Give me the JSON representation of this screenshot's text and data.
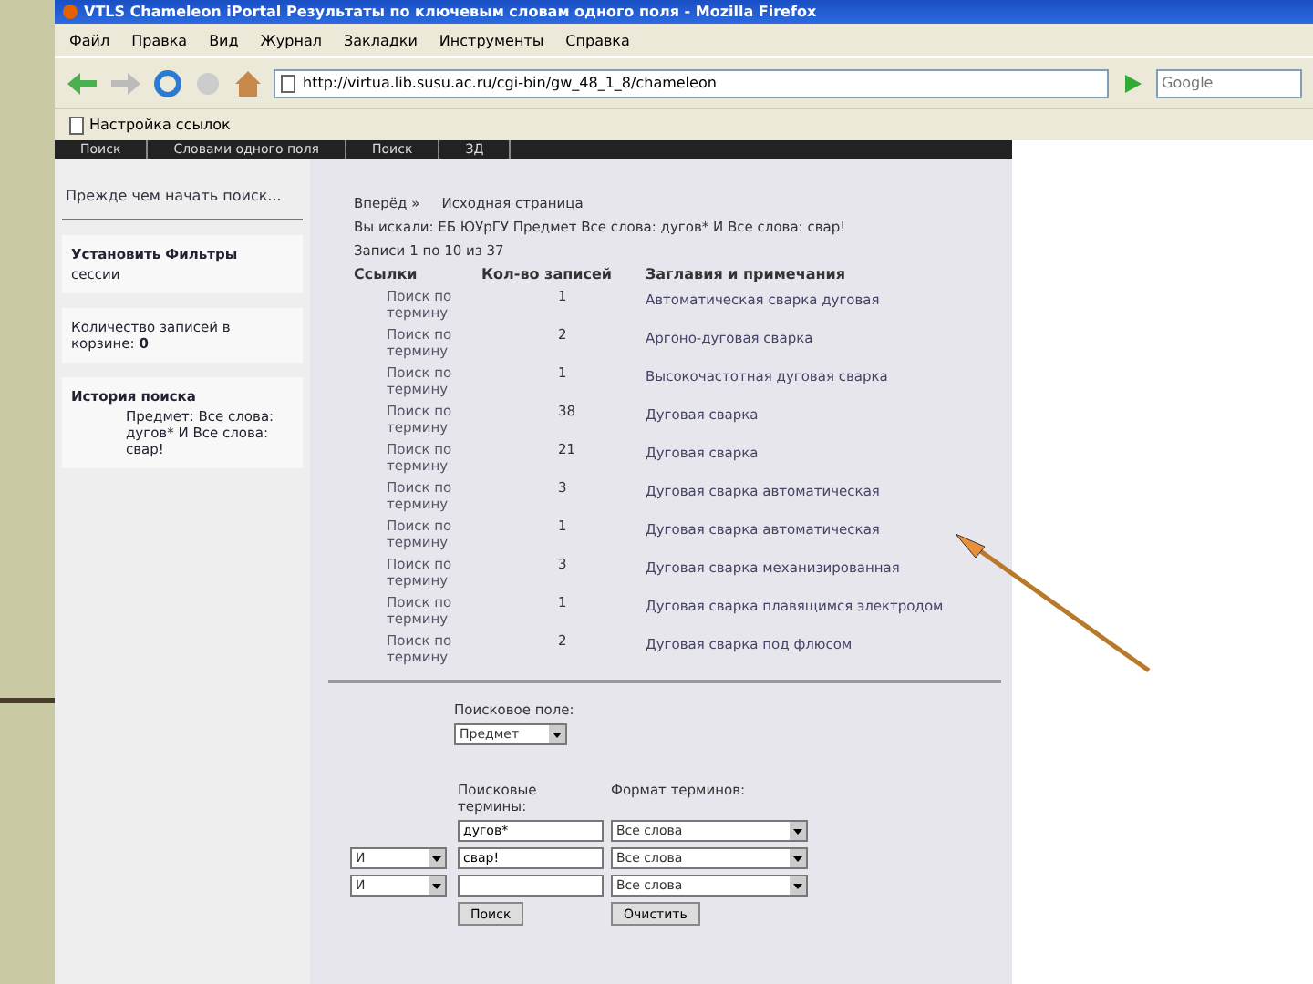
{
  "window": {
    "title": "VTLS Chameleon iPortal Результаты по ключевым словам одного поля - Mozilla Firefox"
  },
  "menu": [
    "Файл",
    "Правка",
    "Вид",
    "Журнал",
    "Закладки",
    "Инструменты",
    "Справка"
  ],
  "address_bar": {
    "value": "http://virtua.lib.susu.ac.ru/cgi-bin/gw_48_1_8/chameleon"
  },
  "web_search": {
    "placeholder": "Google"
  },
  "bookmarks": [
    "Настройка ссылок"
  ],
  "site_nav": [
    "Поиск",
    "Словами одного поля",
    "Поиск",
    "ЗД"
  ],
  "sidebar": {
    "intro": "Прежде чем начать поиск...",
    "filters": {
      "title": "Установить Фильтры",
      "subtitle": "сессии"
    },
    "cart": {
      "label": "Количество записей в корзине:",
      "count": "0"
    },
    "history": {
      "title": "История поиска",
      "entry": "Предмет: Все слова: дугов* И Все слова: свар!"
    }
  },
  "breadcrumb": [
    "Вперёд »",
    "Исходная страница"
  ],
  "query": "Вы искали: ЕБ ЮУрГУ   Предмет   Все слова: дугов* И Все слова: свар!",
  "record_range": "Записи 1 по 10 из 37",
  "table": {
    "columns": [
      "Ссылки",
      "Кол-во записей",
      "Заглавия и примечания"
    ],
    "rows": [
      {
        "link": "Поиск по термину",
        "count": "1",
        "title": "Автоматическая сварка дуговая"
      },
      {
        "link": "Поиск по термину",
        "count": "2",
        "title": "Аргоно-дуговая сварка"
      },
      {
        "link": "Поиск по термину",
        "count": "1",
        "title": "Высокочастотная дуговая сварка"
      },
      {
        "link": "Поиск по термину",
        "count": "38",
        "title": "Дуговая сварка"
      },
      {
        "link": "Поиск по термину",
        "count": "21",
        "title": "Дуговая сварка"
      },
      {
        "link": "Поиск по термину",
        "count": "3",
        "title": "Дуговая сварка автоматическая"
      },
      {
        "link": "Поиск по термину",
        "count": "1",
        "title": "Дуговая сварка автоматическая"
      },
      {
        "link": "Поиск по термину",
        "count": "3",
        "title": "Дуговая сварка механизированная"
      },
      {
        "link": "Поиск по термину",
        "count": "1",
        "title": "Дуговая сварка плавящимся электродом"
      },
      {
        "link": "Поиск по термину",
        "count": "2",
        "title": "Дуговая сварка под флюсом"
      }
    ]
  },
  "search_form": {
    "field_label": "Поисковое поле:",
    "field": "Предмет",
    "terms_label": "Поисковые термины:",
    "format_label": "Формат терминов:",
    "rows": [
      {
        "operator": null,
        "term": "дугов*",
        "format": "Все слова"
      },
      {
        "operator": "И",
        "term": "свар!",
        "format": "Все слова"
      },
      {
        "operator": "И",
        "term": "",
        "format": "Все слова"
      }
    ],
    "buttons": [
      "Поиск",
      "Очистить"
    ]
  }
}
